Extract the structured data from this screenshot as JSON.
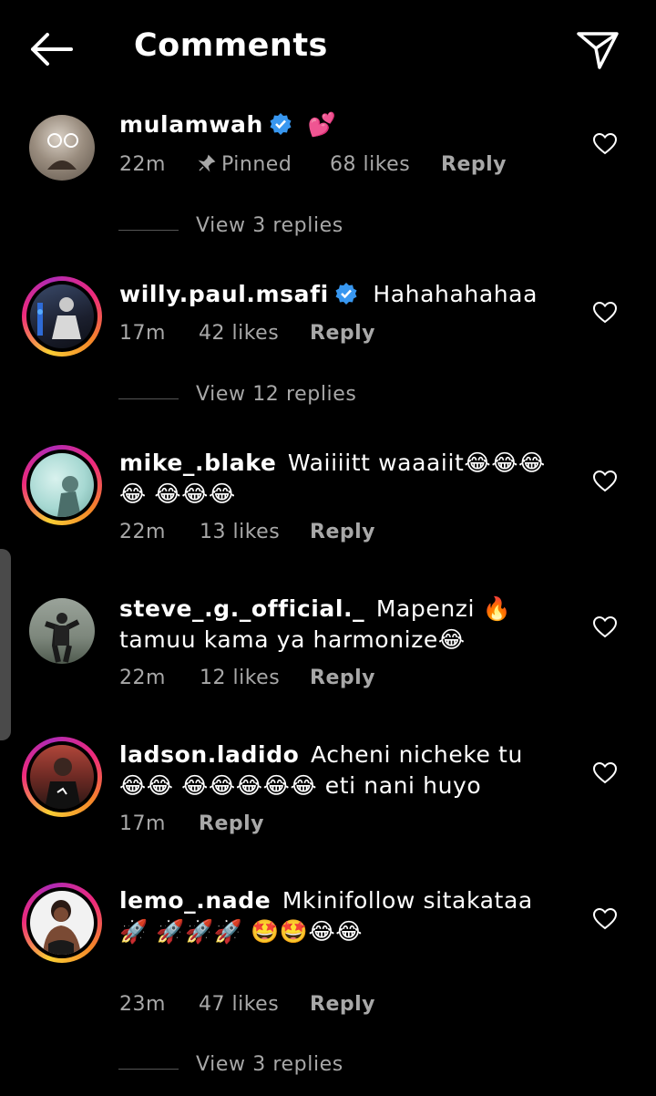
{
  "header": {
    "title": "Comments"
  },
  "comments": [
    {
      "username": "mulamwah",
      "verified": true,
      "text": "💕",
      "time": "22m",
      "pinned_label": "Pinned",
      "likes": "68 likes",
      "reply": "Reply",
      "view_replies": "View 3 replies"
    },
    {
      "username": "willy.paul.msafi",
      "verified": true,
      "text": "Hahahahahaa",
      "time": "17m",
      "likes": "42 likes",
      "reply": "Reply",
      "view_replies": "View 12 replies"
    },
    {
      "username": "mike_.blake",
      "text": "Waiiiitt waaaiit😂😂😂😂 😂😂😂",
      "time": "22m",
      "likes": "13 likes",
      "reply": "Reply"
    },
    {
      "username": "steve_.g._official._",
      "text": "Mapenzi 🔥 tamuu kama ya harmonize😂",
      "time": "22m",
      "likes": "12 likes",
      "reply": "Reply"
    },
    {
      "username": "ladson.ladido",
      "text": "Acheni nicheke tu 😂😂 😂😂😂😂😂 eti nani huyo",
      "time": "17m",
      "reply": "Reply"
    },
    {
      "username": "lemo_.nade",
      "text": "Mkinifollow sitakataa 🚀 🚀🚀🚀 🤩🤩😂😂",
      "time": "23m",
      "likes": "47 likes",
      "reply": "Reply",
      "view_replies": "View 3 replies"
    }
  ],
  "icons": {
    "back": "arrow-left-icon",
    "send": "send-icon",
    "like": "heart-icon",
    "verified": "verified-badge-icon",
    "pin": "pin-icon"
  },
  "colors": {
    "background": "#000000",
    "text": "#ffffff",
    "meta": "#a8a8a8",
    "verified": "#3897f0"
  }
}
